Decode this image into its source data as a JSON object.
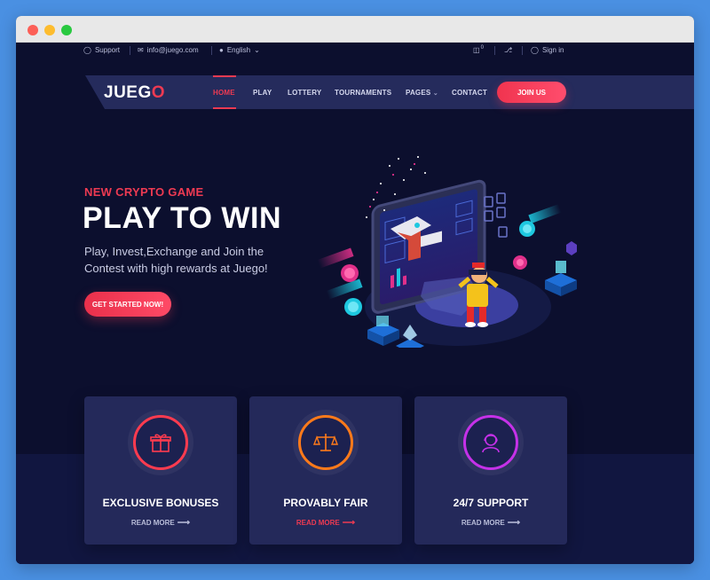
{
  "topbar": {
    "support": "Support",
    "email": "info@juego.com",
    "language": "English",
    "cart_count": "0",
    "sign_in": "Sign in"
  },
  "brand": {
    "logo_main": "JUEG",
    "logo_accent": "O"
  },
  "nav": {
    "items": [
      "HOME",
      "PLAY",
      "LOTTERY",
      "TOURNAMENTS",
      "PAGES",
      "CONTACT"
    ],
    "cta": "JOIN US"
  },
  "hero": {
    "kicker": "NEW CRYPTO GAME",
    "title": "PLAY TO WIN",
    "subtitle": "Play, Invest,Exchange and Join the Contest with high rewards at Juego!",
    "cta": "GET STARTED NOW!"
  },
  "features": [
    {
      "title": "EXCLUSIVE BONUSES",
      "link": "READ MORE",
      "icon": "gift-icon",
      "color": "#ff3b4f"
    },
    {
      "title": "PROVABLY FAIR",
      "link": "READ MORE",
      "icon": "scale-icon",
      "color": "#ff7a1a"
    },
    {
      "title": "24/7 SUPPORT",
      "link": "READ MORE",
      "icon": "support-agent-icon",
      "color": "#c531e8"
    }
  ],
  "colors": {
    "accent": "#ee3a52",
    "background": "#0c0f2e",
    "card": "#24295a"
  }
}
